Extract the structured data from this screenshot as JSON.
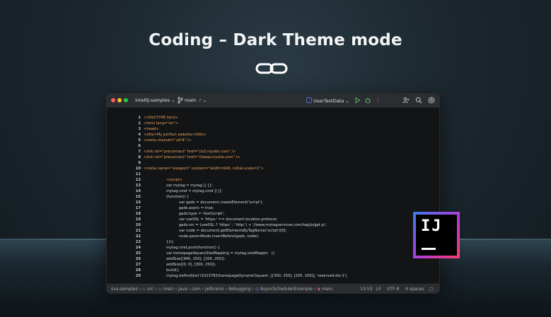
{
  "headline": "Coding – Dark Theme mode",
  "window": {
    "project": "intellij-samples",
    "branch": "main",
    "run_config": "UserTestData"
  },
  "code_lines": [
    {
      "n": "1",
      "t": "<!DOCTYPE html>"
    },
    {
      "n": "2",
      "t": "<html lang=\"en\">"
    },
    {
      "n": "3",
      "t": "<head>"
    },
    {
      "n": "4",
      "t": "<title>My perfect website</title>"
    },
    {
      "n": "5",
      "t": "<meta charset=\"utf-8\" />"
    },
    {
      "n": "6",
      "t": ""
    },
    {
      "n": "7",
      "t": "<link rel=\"preconnect\" href=\"//s3.mysite.com\" />"
    },
    {
      "n": "8",
      "t": "<link rel=\"preconnect\" href=\"//www.mysite.com\" />"
    },
    {
      "n": "9",
      "t": ""
    },
    {
      "n": "10",
      "t": "<meta name=\"viewport\" content=\"width=640, initial-scale=1\">"
    },
    {
      "n": "11",
      "t": ""
    },
    {
      "n": "12",
      "t": "<script>"
    },
    {
      "n": "13",
      "t": "var mytag = mytag || {};"
    },
    {
      "n": "14",
      "t": "mytag.cmd = mytag.cmd || [];"
    },
    {
      "n": "15",
      "t": "(function() {"
    },
    {
      "n": "16",
      "t": "var gads = document.createElement('script');"
    },
    {
      "n": "17",
      "t": "gads.async = true;"
    },
    {
      "n": "18",
      "t": "gads.type = 'text/script';"
    },
    {
      "n": "19",
      "t": "var useSSL = 'https:' == document.location.protocol;"
    },
    {
      "n": "20",
      "t": "gads.src = (useSSL ? 'https:' : 'http:') + '//www.mytagservices.com/tag/js/gpt.js';"
    },
    {
      "n": "21",
      "t": "var node = document.getElementsByTagName('script')[0];"
    },
    {
      "n": "22",
      "t": "node.parentNode.insertBefore(gads, node);"
    },
    {
      "n": "23",
      "t": "})();"
    },
    {
      "n": "24",
      "t": "mytag.cmd.push(function() {"
    },
    {
      "n": "25",
      "t": "var homepageSquarySizeMapping = mytag.sizeMappin   ()."
    },
    {
      "n": "26",
      "t": "addSize([945, 250], [200, 200])."
    },
    {
      "n": "27",
      "t": "addSize([0, 0], [300, 250])."
    },
    {
      "n": "28",
      "t": "build();"
    },
    {
      "n": "29",
      "t": "mytag.defineSlot('/1023782/homepageDynamicSquare', [[300, 250], [200, 200]], 'reserved-div-1')."
    }
  ],
  "statusbar": {
    "crumbs": [
      "sva-samples",
      "src",
      "main",
      "java",
      "com",
      "jetbrains",
      "debugging",
      "AsyncSchedulerExample",
      "main"
    ],
    "position": "13:53",
    "line_sep": "LF",
    "encoding": "UTF-8",
    "indent": "4 spaces"
  },
  "logo": {
    "text": "IJ"
  },
  "icons": {
    "headline_icon": "link-icon",
    "branch": "git-branch-icon",
    "run": "run-icon",
    "debug": "debug-icon",
    "more": "more-icon",
    "account": "add-user-icon",
    "search": "search-icon",
    "settings": "gear-icon"
  },
  "colors": {
    "tag": "#e8a35a",
    "string": "#7ec36d",
    "run": "#5fb865",
    "logo_gradient": [
      "#3a7bf0",
      "#b53ad8",
      "#ff3a6a"
    ]
  }
}
